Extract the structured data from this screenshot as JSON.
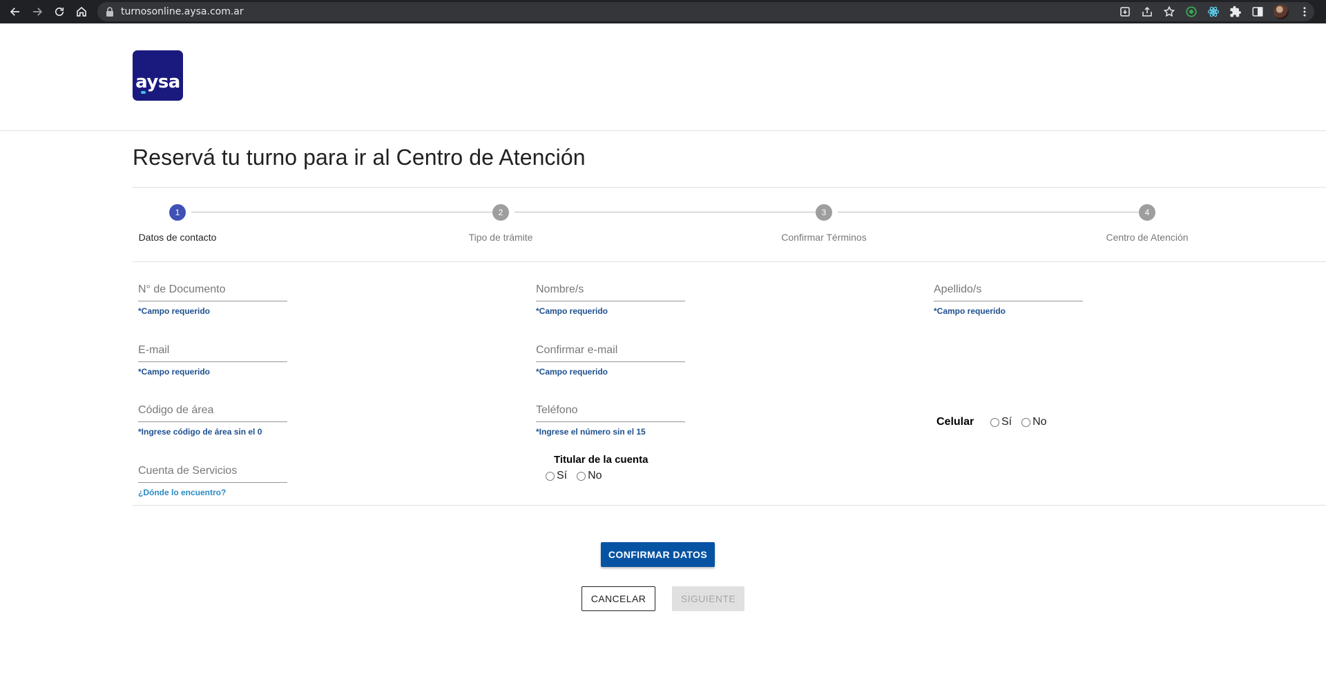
{
  "browser": {
    "url": "turnosonline.aysa.com.ar"
  },
  "brand": {
    "logo_text": "aysa"
  },
  "page": {
    "title": "Reservá tu turno para ir al Centro de Atención"
  },
  "stepper": {
    "active_step": 1,
    "steps": [
      {
        "number": "1",
        "label": "Datos de contacto"
      },
      {
        "number": "2",
        "label": "Tipo de trámite"
      },
      {
        "number": "3",
        "label": "Confirmar Términos"
      },
      {
        "number": "4",
        "label": "Centro de Atención"
      }
    ]
  },
  "form": {
    "documento": {
      "placeholder": "N° de Documento",
      "value": "",
      "hint": "*Campo requerido"
    },
    "nombre": {
      "placeholder": "Nombre/s",
      "value": "",
      "hint": "*Campo requerido"
    },
    "apellido": {
      "placeholder": "Apellido/s",
      "value": "",
      "hint": "*Campo requerido"
    },
    "email": {
      "placeholder": "E-mail",
      "value": "",
      "hint": "*Campo requerido"
    },
    "confirmar_email": {
      "placeholder": "Confirmar e-mail",
      "value": "",
      "hint": "*Campo requerido"
    },
    "codigo_area": {
      "placeholder": "Código de área",
      "value": "",
      "hint": "*Ingrese código de área sin el 0"
    },
    "telefono": {
      "placeholder": "Teléfono",
      "value": "",
      "hint": "*Ingrese el número sin el 15"
    },
    "celular": {
      "label": "Celular",
      "option_yes": "Sí",
      "option_no": "No",
      "selected": null
    },
    "cuenta": {
      "placeholder": "Cuenta de Servicios",
      "value": "",
      "help_link": "¿Dónde lo encuentro?"
    },
    "titular": {
      "label": "Titular de la cuenta",
      "option_yes": "Sí",
      "option_no": "No",
      "selected": null
    }
  },
  "actions": {
    "confirm_label": "CONFIRMAR DATOS",
    "cancel_label": "CANCELAR",
    "next_label": "SIGUIENTE",
    "next_disabled": true
  },
  "colors": {
    "brand": "#1a1a7e",
    "step_active": "#3f51b5",
    "primary_button": "#0753a3",
    "hint_text": "#1e4f8e",
    "link": "#2a8ac4"
  }
}
